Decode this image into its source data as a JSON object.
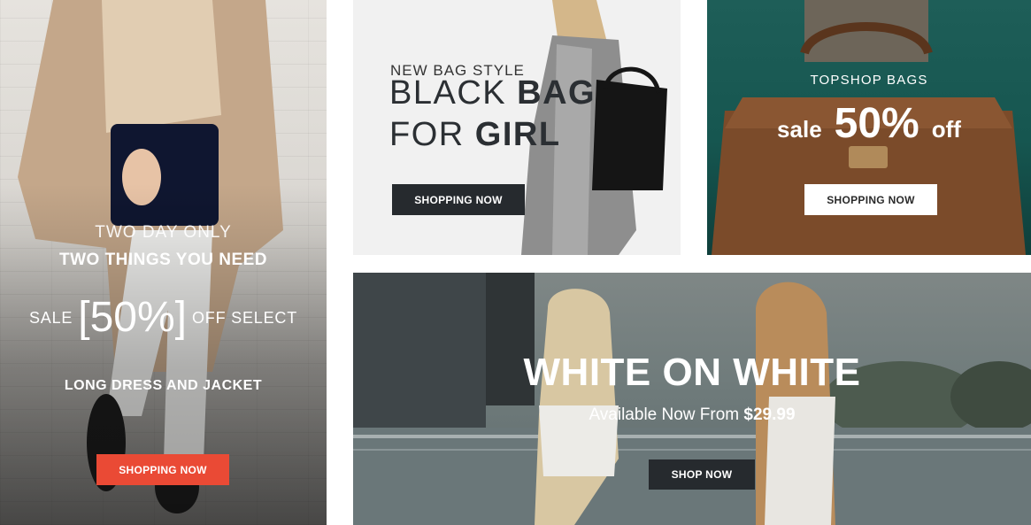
{
  "banners": {
    "two_day": {
      "line1": "TWO DAY ONLY",
      "line2": "TWO THINGS YOU NEED",
      "sale_word": "SALE",
      "discount": "[50%]",
      "off_word": "OFF SELECT",
      "line4": "LONG DRESS AND JACKET",
      "button": "SHOPPING NOW",
      "button_color": "#ea4a35"
    },
    "black_bag": {
      "eyebrow": "NEW BAG STYLE",
      "title_light_1": "BLACK ",
      "title_bold_1": "BAG",
      "title_light_2": "FOR ",
      "title_bold_2": "GIRL",
      "button": "SHOPPING NOW",
      "button_color": "#262a2e"
    },
    "topshop": {
      "eyebrow": "TOPSHOP BAGS",
      "sale_word": "sale",
      "discount": "50%",
      "off_word": "off",
      "button": "SHOPPING NOW",
      "button_color": "#ffffff"
    },
    "white_on_white": {
      "title": "WHITE ON WHITE",
      "subtitle_prefix": "Available Now From ",
      "price": "$29.99",
      "button": "SHOP NOW",
      "button_color": "#262a2e"
    }
  }
}
